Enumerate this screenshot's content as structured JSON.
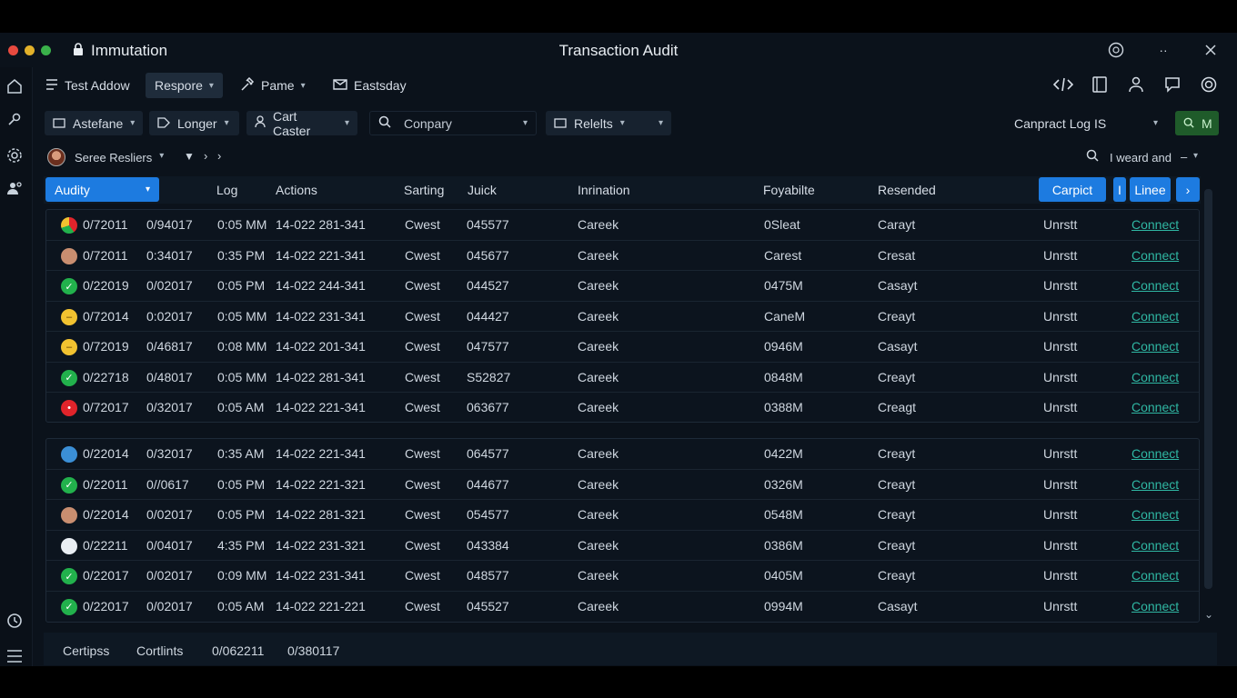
{
  "titlebar": {
    "app_name": "Immutation",
    "window_title": "Transaction Audit",
    "dot_colors": [
      "#e84a3f",
      "#e2b12a",
      "#3ab14a"
    ]
  },
  "toolbar": {
    "items": [
      "Test Addow",
      "Respore",
      "Pame",
      "Eastsday"
    ]
  },
  "filters": {
    "astefane": "Astefane",
    "longer": "Longer",
    "cart_caster": "Cart Caster",
    "company_placeholder": "Conpary",
    "relelts": "Relelts",
    "log_select": "Canpract Log IS",
    "green_button": "M"
  },
  "row3": {
    "saved_results": "Seree Resliers",
    "search_text": "I weard and"
  },
  "table": {
    "audity_label": "Audity",
    "headers": {
      "log": "Log",
      "actions": "Actions",
      "sarting": "Sarting",
      "juick": "Juick",
      "inrination": "Inrination",
      "foyabilte": "Foyabilte",
      "resended": "Resended"
    },
    "header_buttons": {
      "carpict": "Carpict",
      "i": "I",
      "linee": "Linee",
      "next": "›"
    },
    "group1": [
      {
        "status": "red-multi",
        "date": "0/72011",
        "id": "0/94017",
        "time": "0:05 MM",
        "actions": "14-022 281-341",
        "sarting": "Cwest",
        "juick": "045577",
        "inrination": "Careek",
        "foyabilte": "0Sleat",
        "resended": "Carayt",
        "state": "Unrstt",
        "link": "Connect"
      },
      {
        "status": "face",
        "date": "0/72011",
        "id": "0:34017",
        "time": "0:35 PM",
        "actions": "14-022 221-341",
        "sarting": "Cwest",
        "juick": "045677",
        "inrination": "Careek",
        "foyabilte": "Carest",
        "resended": "Cresat",
        "state": "Unrstt",
        "link": "Connect"
      },
      {
        "status": "check",
        "date": "0/22019",
        "id": "0/02017",
        "time": "0:05 PM",
        "actions": "14-022 244-341",
        "sarting": "Cwest",
        "juick": "044527",
        "inrination": "Careek",
        "foyabilte": "0475M",
        "resended": "Casayt",
        "state": "Unrstt",
        "link": "Connect"
      },
      {
        "status": "emoji",
        "date": "0/72014",
        "id": "0:02017",
        "time": "0:05 MM",
        "actions": "14-022 231-341",
        "sarting": "Cwest",
        "juick": "044427",
        "inrination": "Careek",
        "foyabilte": "CaneM",
        "resended": "Creayt",
        "state": "Unrstt",
        "link": "Connect"
      },
      {
        "status": "emoji",
        "date": "0/72019",
        "id": "0/46817",
        "time": "0:08 MM",
        "actions": "14-022 201-341",
        "sarting": "Cwest",
        "juick": "047577",
        "inrination": "Careek",
        "foyabilte": "0946M",
        "resended": "Casayt",
        "state": "Unrstt",
        "link": "Connect"
      },
      {
        "status": "check",
        "date": "0/22718",
        "id": "0/48017",
        "time": "0:05 MM",
        "actions": "14-022 281-341",
        "sarting": "Cwest",
        "juick": "S52827",
        "inrination": "Careek",
        "foyabilte": "0848M",
        "resended": "Creayt",
        "state": "Unrstt",
        "link": "Connect"
      },
      {
        "status": "red",
        "date": "0/72017",
        "id": "0/32017",
        "time": "0:05 AM",
        "actions": "14-022 221-341",
        "sarting": "Cwest",
        "juick": "063677",
        "inrination": "Careek",
        "foyabilte": "0388M",
        "resended": "Creagt",
        "state": "Unrstt",
        "link": "Connect"
      }
    ],
    "group2": [
      {
        "status": "face-blue",
        "date": "0/22014",
        "id": "0/32017",
        "time": "0:35 AM",
        "actions": "14-022 221-341",
        "sarting": "Cwest",
        "juick": "064577",
        "inrination": "Careek",
        "foyabilte": "0422M",
        "resended": "Creayt",
        "state": "Unrstt",
        "link": "Connect"
      },
      {
        "status": "check",
        "date": "0/22011",
        "id": "0//0617",
        "time": "0:05 PM",
        "actions": "14-022 221-321",
        "sarting": "Cwest",
        "juick": "044677",
        "inrination": "Careek",
        "foyabilte": "0326M",
        "resended": "Creayt",
        "state": "Unrstt",
        "link": "Connect"
      },
      {
        "status": "face",
        "date": "0/22014",
        "id": "0/02017",
        "time": "0:05 PM",
        "actions": "14-022 281-321",
        "sarting": "Cwest",
        "juick": "054577",
        "inrination": "Careek",
        "foyabilte": "0548M",
        "resended": "Creayt",
        "state": "Unrstt",
        "link": "Connect"
      },
      {
        "status": "face-white",
        "date": "0/22211",
        "id": "0/04017",
        "time": "4:35 PM",
        "actions": "14-022 231-321",
        "sarting": "Cwest",
        "juick": "043384",
        "inrination": "Careek",
        "foyabilte": "0386M",
        "resended": "Creayt",
        "state": "Unrstt",
        "link": "Connect"
      },
      {
        "status": "check",
        "date": "0/22017",
        "id": "0/02017",
        "time": "0:09 MM",
        "actions": "14-022 231-341",
        "sarting": "Cwest",
        "juick": "048577",
        "inrination": "Careek",
        "foyabilte": "0405M",
        "resended": "Creayt",
        "state": "Unrstt",
        "link": "Connect"
      },
      {
        "status": "check",
        "date": "0/22017",
        "id": "0/02017",
        "time": "0:05 AM",
        "actions": "14-022 221-221",
        "sarting": "Cwest",
        "juick": "045527",
        "inrination": "Careek",
        "foyabilte": "0994M",
        "resended": "Casayt",
        "state": "Unrstt",
        "link": "Connect"
      }
    ]
  },
  "footer": {
    "a": "Certipss",
    "b": "Cortlints",
    "c": "0/062211",
    "d": "0/380117"
  },
  "colors": {
    "accent": "#1d7be0",
    "link": "#2fb7a3",
    "success": "#22b14c",
    "danger": "#e0242b",
    "warn": "#f2c230"
  }
}
